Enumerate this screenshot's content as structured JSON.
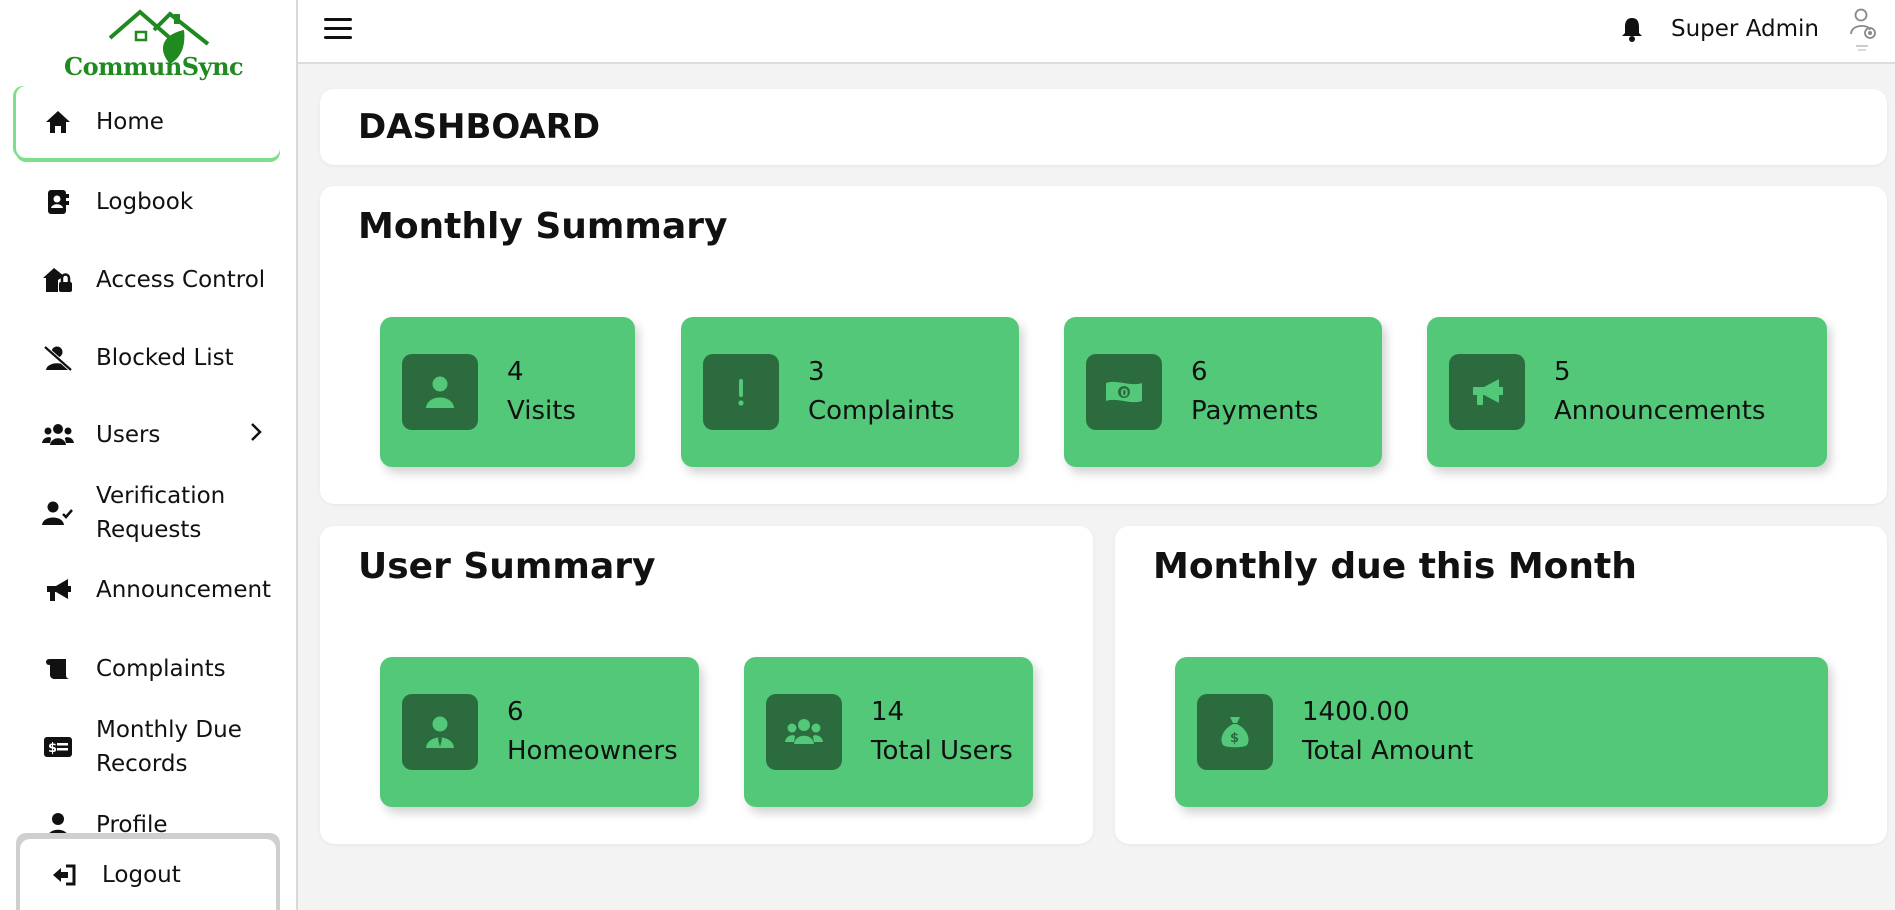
{
  "brand": {
    "name": "CommunSync"
  },
  "colors": {
    "accent": "#52c878",
    "badge": "#2b6b3d",
    "active_border": "#7ddf8a"
  },
  "sidebar": {
    "items": [
      {
        "label": "Home",
        "icon": "home-icon"
      },
      {
        "label": "Logbook",
        "icon": "logbook-icon"
      },
      {
        "label": "Access Control",
        "icon": "house-lock-icon"
      },
      {
        "label": "Blocked List",
        "icon": "user-slash-icon"
      },
      {
        "label": "Users",
        "icon": "users-icon"
      },
      {
        "label": "Verification Requests",
        "icon": "user-check-icon"
      },
      {
        "label": "Announcement",
        "icon": "megaphone-icon"
      },
      {
        "label": "Complaints",
        "icon": "scroll-icon"
      },
      {
        "label": "Monthly Due Records",
        "icon": "money-card-icon"
      },
      {
        "label": "Profile",
        "icon": "user-icon"
      }
    ],
    "logout": "Logout"
  },
  "header": {
    "admin_name": "Super Admin"
  },
  "page": {
    "title": "DASHBOARD"
  },
  "monthly_summary": {
    "title": "Monthly Summary",
    "stats": [
      {
        "value": "4",
        "label": "Visits",
        "icon": "user-icon"
      },
      {
        "value": "3",
        "label": "Complaints",
        "icon": "exclamation-icon"
      },
      {
        "value": "6",
        "label": "Payments",
        "icon": "money-bill-icon"
      },
      {
        "value": "5",
        "label": "Announcements",
        "icon": "megaphone-icon"
      }
    ]
  },
  "user_summary": {
    "title": "User Summary",
    "stats": [
      {
        "value": "6",
        "label": "Homeowners",
        "icon": "user-tie-icon"
      },
      {
        "value": "14",
        "label": "Total Users",
        "icon": "users-icon"
      }
    ]
  },
  "monthly_due": {
    "title": "Monthly due this Month",
    "stats": [
      {
        "value": "1400.00",
        "label": "Total Amount",
        "icon": "money-bag-icon"
      }
    ]
  }
}
